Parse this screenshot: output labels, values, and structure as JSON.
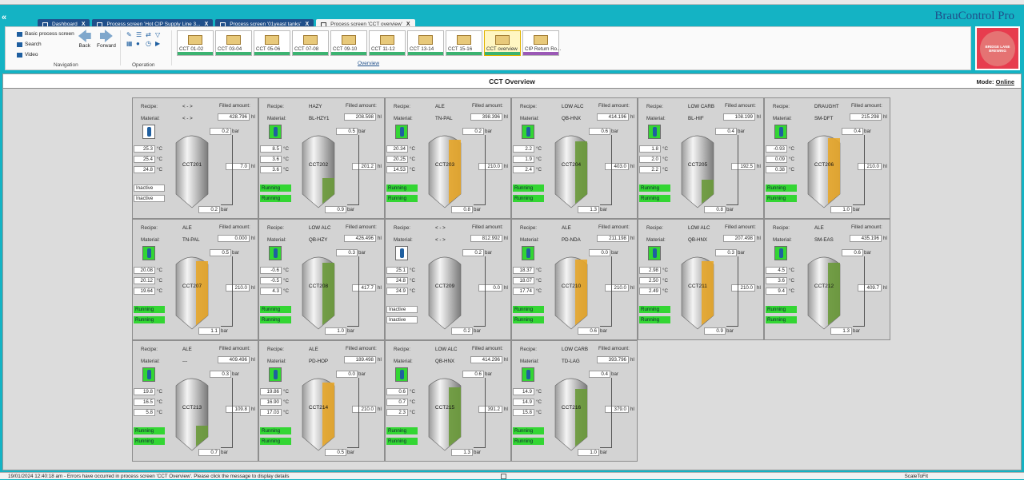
{
  "app": {
    "brand": "BrauControl Pro",
    "tabs": [
      {
        "label": "Dashboard",
        "active": false
      },
      {
        "label": "Process screen 'Hot CIP Supply Line 3...",
        "active": false
      },
      {
        "label": "Process screen '01yeast tanks'",
        "active": false
      },
      {
        "label": "Process screen 'CCT overview'",
        "active": true
      }
    ],
    "close_glyph": "X",
    "collapse_glyph": "«"
  },
  "ribbon": {
    "navigation": {
      "items": [
        "Basic process screen",
        "Search",
        "Video"
      ],
      "back": "Back",
      "forward": "Forward",
      "label": "Navigation"
    },
    "operation_label": "Operation",
    "thumbnails": [
      "CCT 01-02",
      "CCT 03-04",
      "CCT 05-06",
      "CCT 07-08",
      "CCT 09-10",
      "CCT 11-12",
      "CCT 13-14",
      "CCT 15-16",
      "CCT overview",
      "CIP Return Ro..."
    ],
    "overview_label": "Overview"
  },
  "logo_text": "BRIDGE LANE BREWING",
  "page": {
    "title": "CCT Overview",
    "mode_label": "Mode:",
    "mode_value": "Online"
  },
  "labels": {
    "recipe": "Recipe:",
    "material": "Material:",
    "filled": "Filled amount:",
    "hl": "hl",
    "celsius": "°C",
    "bar": "bar"
  },
  "colors": {
    "running": "#33d633",
    "beer": "#e8a72a",
    "green_beer": "#6a9a3a"
  },
  "tanks": [
    {
      "name": "CCT201",
      "recipe": "< - >",
      "material": "< - >",
      "filled": "428.796",
      "temps": [
        "25.3",
        "25.4",
        "24.8"
      ],
      "status": [
        "Inactive",
        "Inactive"
      ],
      "top_bar": "0.2",
      "bottom_bar": "0.2",
      "level": "7.0",
      "fill": 0,
      "liquid": "none",
      "pump": "off"
    },
    {
      "name": "CCT202",
      "recipe": "HAZY",
      "material": "BL-HZY1",
      "filled": "208.598",
      "temps": [
        "8.5",
        "3.6",
        "3.6"
      ],
      "status": [
        "Running",
        "Running"
      ],
      "top_bar": "0.5",
      "bottom_bar": "0.9",
      "level": "201.2",
      "fill": 0.32,
      "liquid": "green",
      "pump": "on"
    },
    {
      "name": "CCT203",
      "recipe": "ALE",
      "material": "TN-PAL",
      "filled": "398.396",
      "temps": [
        "20.34",
        "20.25",
        "14.53"
      ],
      "status": [
        "Running",
        "Running"
      ],
      "top_bar": "0.2",
      "bottom_bar": "0.8",
      "level": "210.0",
      "fill": 0.92,
      "liquid": "amber",
      "pump": "on"
    },
    {
      "name": "CCT204",
      "recipe": "LOW ALC",
      "material": "QB-HNX",
      "filled": "414.196",
      "temps": [
        "2.2",
        "1.9",
        "2.4"
      ],
      "status": [
        "Running",
        "Running"
      ],
      "top_bar": "0.6",
      "bottom_bar": "1.3",
      "level": "403.0",
      "fill": 0.9,
      "liquid": "green",
      "pump": "on"
    },
    {
      "name": "CCT205",
      "recipe": "LOW CARB",
      "material": "BL-HIF",
      "filled": "108.199",
      "temps": [
        "1.8",
        "2.0",
        "2.2"
      ],
      "status": [
        "Running",
        "Running"
      ],
      "top_bar": "0.4",
      "bottom_bar": "0.8",
      "level": "192.5",
      "fill": 0.3,
      "liquid": "green",
      "pump": "on"
    },
    {
      "name": "CCT206",
      "recipe": "DRAUGHT",
      "material": "SM-DFT",
      "filled": "215.298",
      "temps": [
        "-0.93",
        "0.09",
        "0.38"
      ],
      "status": [
        "Running",
        "Running"
      ],
      "top_bar": "0.4",
      "bottom_bar": "1.0",
      "level": "210.0",
      "fill": 0.95,
      "liquid": "amber",
      "pump": "on"
    },
    {
      "name": "CCT207",
      "recipe": "ALE",
      "material": "TN-PAL",
      "filled": "0.000",
      "temps": [
        "20.08",
        "20.12",
        "19.64"
      ],
      "status": [
        "Running",
        "Running"
      ],
      "top_bar": "0.5",
      "bottom_bar": "1.1",
      "level": "210.0",
      "fill": 0.93,
      "liquid": "amber",
      "pump": "on"
    },
    {
      "name": "CCT208",
      "recipe": "LOW ALC",
      "material": "QB-HZY",
      "filled": "426.496",
      "temps": [
        "-0.6",
        "-0.5",
        "4.3"
      ],
      "status": [
        "Running",
        "Running"
      ],
      "top_bar": "0.3",
      "bottom_bar": "1.0",
      "level": "417.7",
      "fill": 0.9,
      "liquid": "green",
      "pump": "on"
    },
    {
      "name": "CCT209",
      "recipe": "< - >",
      "material": "< - >",
      "filled": "812.992",
      "temps": [
        "25.1",
        "24.8",
        "24.9"
      ],
      "status": [
        "Inactive",
        "Inactive"
      ],
      "top_bar": "0.2",
      "bottom_bar": "0.2",
      "level": "0.0",
      "fill": 0,
      "liquid": "none",
      "pump": "off"
    },
    {
      "name": "CCT210",
      "recipe": "ALE",
      "material": "PD-NDA",
      "filled": "211.198",
      "temps": [
        "18.37",
        "18.07",
        "17.74"
      ],
      "status": [
        "Running",
        "Running"
      ],
      "top_bar": "0.0",
      "bottom_bar": "0.6",
      "level": "210.0",
      "fill": 0.95,
      "liquid": "amber",
      "pump": "on"
    },
    {
      "name": "CCT211",
      "recipe": "LOW ALC",
      "material": "QB-HNX",
      "filled": "207.498",
      "temps": [
        "2.98",
        "2.50",
        "2.49"
      ],
      "status": [
        "Running",
        "Running"
      ],
      "top_bar": "0.3",
      "bottom_bar": "0.9",
      "level": "210.0",
      "fill": 0.93,
      "liquid": "amber",
      "pump": "on"
    },
    {
      "name": "CCT212",
      "recipe": "ALE",
      "material": "SM-EAS",
      "filled": "435.196",
      "temps": [
        "4.5",
        "3.6",
        "9.4"
      ],
      "status": [
        "Running",
        "Running"
      ],
      "top_bar": "0.6",
      "bottom_bar": "1.3",
      "level": "409.7",
      "fill": 0.9,
      "liquid": "green",
      "pump": "on"
    },
    {
      "name": "CCT213",
      "recipe": "ALE",
      "material": "---",
      "filled": "409.496",
      "temps": [
        "19.8",
        "16.5",
        "5.8"
      ],
      "status": [
        "Running",
        "Running"
      ],
      "top_bar": "0.3",
      "bottom_bar": "0.7",
      "level": "109.8",
      "fill": 0.25,
      "liquid": "green",
      "pump": "on"
    },
    {
      "name": "CCT214",
      "recipe": "ALE",
      "material": "PD-HOP",
      "filled": "189.498",
      "temps": [
        "19.86",
        "16.90",
        "17.03"
      ],
      "status": [
        "Running",
        "Running"
      ],
      "top_bar": "0.0",
      "bottom_bar": "0.5",
      "level": "210.0",
      "fill": 0.93,
      "liquid": "amber",
      "pump": "on"
    },
    {
      "name": "CCT215",
      "recipe": "LOW ALC",
      "material": "QB-HNX",
      "filled": "414.296",
      "temps": [
        "0.6",
        "0.7",
        "2.3"
      ],
      "status": [
        "Running",
        "Running"
      ],
      "top_bar": "0.6",
      "bottom_bar": "1.3",
      "level": "391.2",
      "fill": 0.85,
      "liquid": "green",
      "pump": "on"
    },
    {
      "name": "CCT216",
      "recipe": "LOW CARB",
      "material": "TD-LAG",
      "filled": "393.796",
      "temps": [
        "14.9",
        "14.9",
        "15.8"
      ],
      "status": [
        "Running",
        "Running"
      ],
      "top_bar": "0.4",
      "bottom_bar": "1.0",
      "level": "379.0",
      "fill": 0.82,
      "liquid": "green",
      "pump": "on"
    }
  ],
  "statusbar": {
    "message": "19/01/2024 12:40:18 am - Errors have occurred in process screen 'CCT Overview'. Please click the message to display details",
    "scale": "ScaleToFit"
  }
}
